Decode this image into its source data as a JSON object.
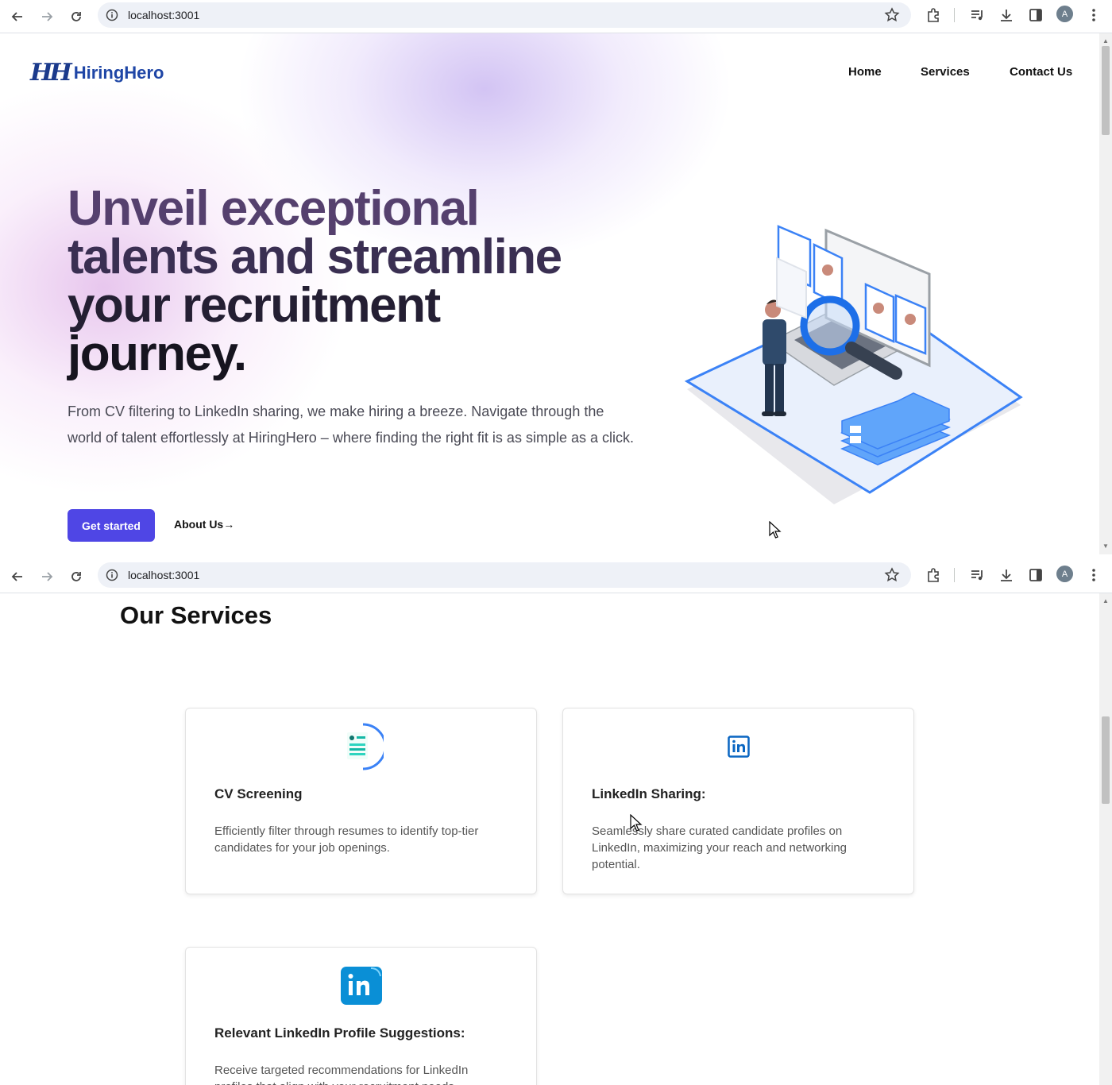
{
  "browser": {
    "url": "localhost:3001",
    "avatar_letter": "A",
    "icons": [
      "back-icon",
      "forward-icon",
      "reload-icon",
      "site-info-icon",
      "bookmark-star-icon",
      "extensions-icon",
      "media-icon",
      "download-icon",
      "side-panel-icon",
      "menu-icon"
    ]
  },
  "header": {
    "logo_mark": "HH",
    "logo_text": "HiringHero",
    "nav": [
      "Home",
      "Services",
      "Contact Us"
    ]
  },
  "hero": {
    "title_lines": [
      "Unveil exceptional",
      "talents and streamline",
      "your recruitment",
      "journey."
    ],
    "subtitle": "From CV filtering to LinkedIn sharing, we make hiring a breeze. Navigate through the world of talent effortlessly at HiringHero – where finding the right fit is as simple as a click.",
    "primary_cta": "Get started",
    "secondary_cta": "About Us→"
  },
  "services": {
    "title": "Our Services",
    "cards": [
      {
        "title": "CV Screening",
        "description": "Efficiently filter through resumes to identify top-tier candidates for your job openings.",
        "icon": "cv-document-icon"
      },
      {
        "title": "LinkedIn Sharing:",
        "description": "Seamlessly share curated candidate profiles on LinkedIn, maximizing your reach and networking potential.",
        "icon": "linkedin-icon"
      },
      {
        "title": "Relevant LinkedIn Profile Suggestions:",
        "description": "Receive targeted recommendations for LinkedIn profiles that align with your recruitment needs.",
        "icon": "linkedin-badge-icon"
      }
    ]
  },
  "colors": {
    "primary": "#4f46e5",
    "logo": "#1f46a6",
    "linkedin": "#0a66c2"
  }
}
